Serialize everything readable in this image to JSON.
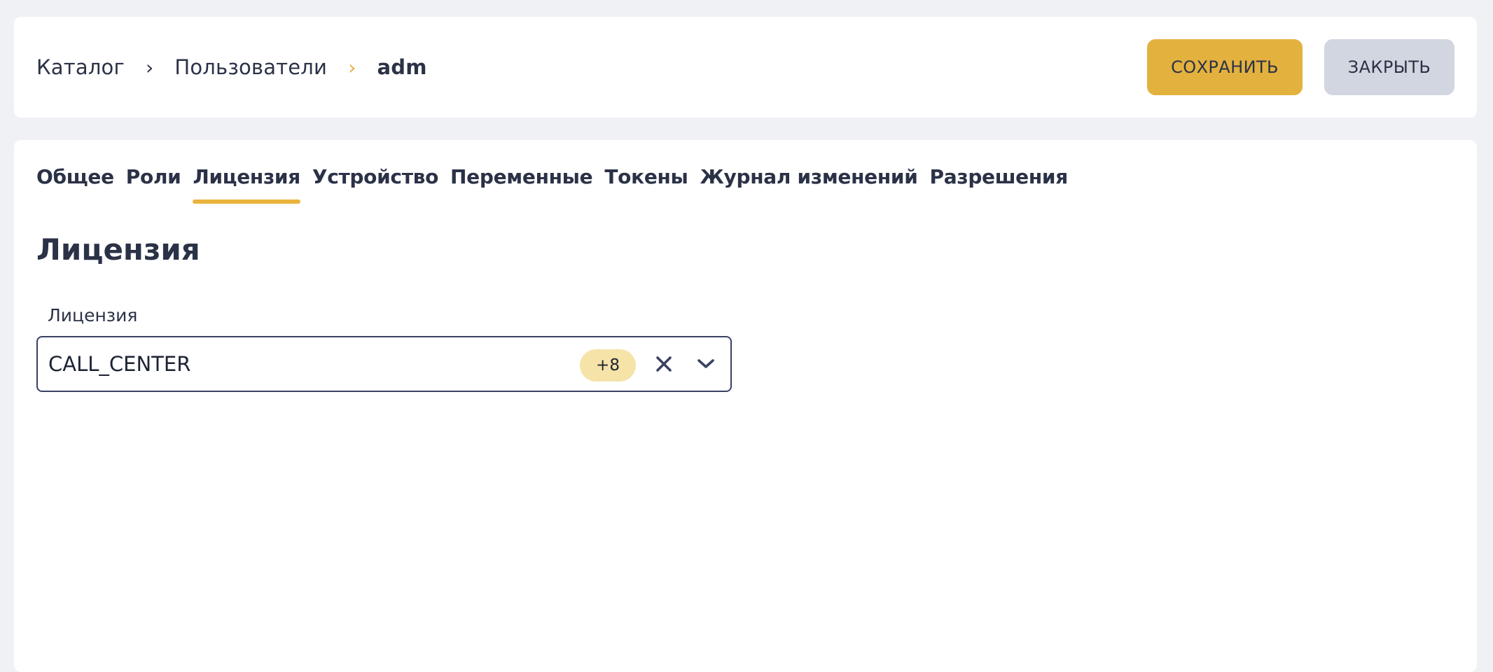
{
  "breadcrumb": {
    "items": [
      "Каталог",
      "Пользователи",
      "adm"
    ]
  },
  "toolbar": {
    "save_label": "СОХРАНИТЬ",
    "close_label": "ЗАКРЫТЬ"
  },
  "tabs": [
    {
      "label": "Общее",
      "active": false
    },
    {
      "label": "Роли",
      "active": false
    },
    {
      "label": "Лицензия",
      "active": true
    },
    {
      "label": "Устройство",
      "active": false
    },
    {
      "label": "Переменные",
      "active": false
    },
    {
      "label": "Токены",
      "active": false
    },
    {
      "label": "Журнал изменений",
      "active": false
    },
    {
      "label": "Разрешения",
      "active": false
    }
  ],
  "section": {
    "title": "Лицензия",
    "field_label": "Лицензия",
    "field_value": "CALL_CENTER",
    "more_count": "+8"
  },
  "icons": {
    "breadcrumb_separator": "chevron-right-icon",
    "clear": "close-icon",
    "dropdown": "chevron-down-icon"
  },
  "colors": {
    "accent": "#e3b13e",
    "secondary_button": "#d2d6e0",
    "badge": "#f5e3a8",
    "text": "#2b3247",
    "background": "#eff1f5"
  }
}
